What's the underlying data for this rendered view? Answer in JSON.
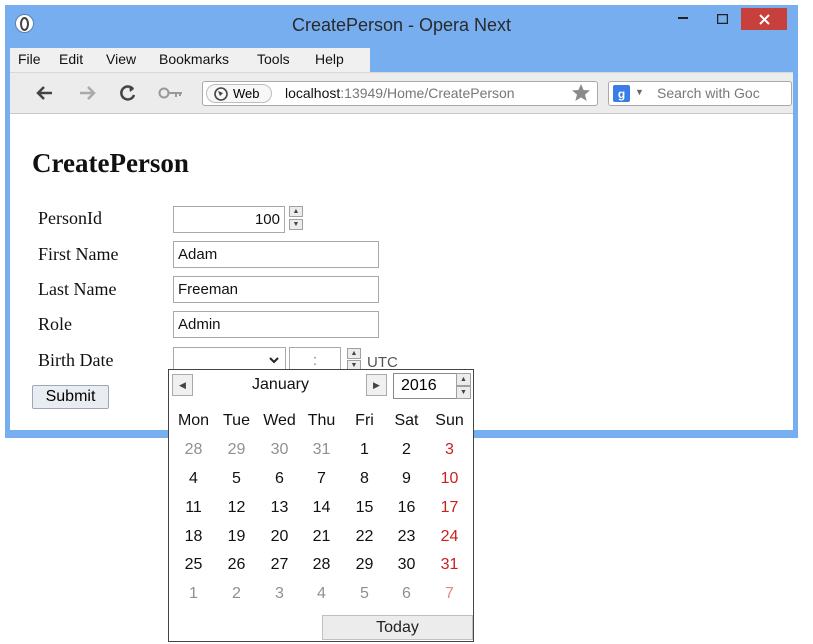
{
  "window": {
    "title": "CreatePerson - Opera Next"
  },
  "colors": {
    "window_frame": "#76aef0",
    "close_button": "#c7403b",
    "sunday": "#cc1f1f",
    "muted_day": "#909090",
    "muted_sunday": "#e08a8a"
  },
  "menu": {
    "items": [
      "File",
      "Edit",
      "View",
      "Bookmarks",
      "Tools",
      "Help"
    ]
  },
  "toolbar": {
    "icons": [
      "back-arrow-icon",
      "forward-arrow-icon",
      "reload-icon",
      "key-icon"
    ],
    "web_label": "Web",
    "url_host": "localhost",
    "url_rest": ":13949/Home/CreatePerson",
    "search_placeholder": "Search with Goc"
  },
  "page": {
    "title": "CreatePerson",
    "fields": {
      "personid": {
        "label": "PersonId",
        "value": "100"
      },
      "firstname": {
        "label": "First Name",
        "value": "Adam"
      },
      "lastname": {
        "label": "Last Name",
        "value": "Freeman"
      },
      "role": {
        "label": "Role",
        "value": "Admin"
      },
      "birthdate": {
        "label": "Birth Date",
        "select_value": "",
        "time_value": ":",
        "timezone": "UTC"
      }
    },
    "submit_label": "Submit"
  },
  "calendar": {
    "month": "January",
    "year": "2016",
    "weekdays": [
      "Mon",
      "Tue",
      "Wed",
      "Thu",
      "Fri",
      "Sat",
      "Sun"
    ],
    "weeks": [
      [
        "28",
        "29",
        "30",
        "31",
        "1",
        "2",
        "3"
      ],
      [
        "4",
        "5",
        "6",
        "7",
        "8",
        "9",
        "10"
      ],
      [
        "11",
        "12",
        "13",
        "14",
        "15",
        "16",
        "17"
      ],
      [
        "18",
        "19",
        "20",
        "21",
        "22",
        "23",
        "24"
      ],
      [
        "25",
        "26",
        "27",
        "28",
        "29",
        "30",
        "31"
      ],
      [
        "1",
        "2",
        "3",
        "4",
        "5",
        "6",
        "7"
      ]
    ],
    "outside_month": [
      [
        true,
        true,
        true,
        true,
        false,
        false,
        false
      ],
      [
        false,
        false,
        false,
        false,
        false,
        false,
        false
      ],
      [
        false,
        false,
        false,
        false,
        false,
        false,
        false
      ],
      [
        false,
        false,
        false,
        false,
        false,
        false,
        false
      ],
      [
        false,
        false,
        false,
        false,
        false,
        false,
        false
      ],
      [
        true,
        true,
        true,
        true,
        true,
        true,
        true
      ]
    ],
    "today_label": "Today"
  }
}
